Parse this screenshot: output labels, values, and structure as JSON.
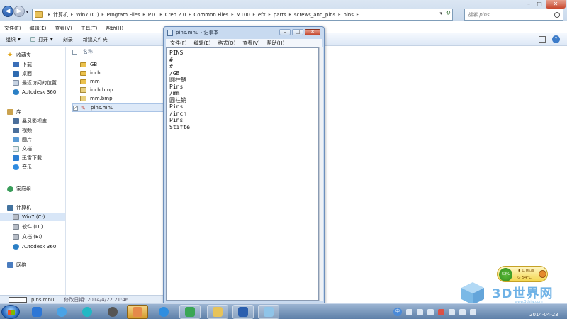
{
  "explorer": {
    "breadcrumbs": [
      "计算机",
      "Win7 (C:)",
      "Program Files",
      "PTC",
      "Creo 2.0",
      "Common Files",
      "M100",
      "efx",
      "parts",
      "screws_and_pins",
      "pins"
    ],
    "search_placeholder": "搜索 pins",
    "menu": [
      "文件(F)",
      "编辑(E)",
      "查看(V)",
      "工具(T)",
      "帮助(H)"
    ],
    "toolbar": {
      "organize": "组织",
      "open": "打开",
      "burn": "刻录",
      "new_folder": "新建文件夹"
    },
    "nav": {
      "favorites_header": "收藏夹",
      "favorites": [
        "下载",
        "桌面",
        "最近访问的位置",
        "Autodesk 360"
      ],
      "libraries_header": "库",
      "libraries": [
        "暴风影视库",
        "视频",
        "图片",
        "文档",
        "迅雷下载",
        "音乐"
      ],
      "homegroup": "家庭组",
      "computer_header": "计算机",
      "drives": [
        "Win7 (C:)",
        "软件 (D:)",
        "文档 (E:)",
        "Autodesk 360"
      ],
      "network": "网络"
    },
    "column_name": "名称",
    "files": [
      {
        "name": "GB",
        "type": "folder"
      },
      {
        "name": "inch",
        "type": "folder"
      },
      {
        "name": "mm",
        "type": "folder"
      },
      {
        "name": "inch.bmp",
        "type": "bmp"
      },
      {
        "name": "mm.bmp",
        "type": "bmp"
      },
      {
        "name": "pins.mnu",
        "type": "mnu",
        "selected": true
      }
    ],
    "details": {
      "filename": "pins.mnu",
      "modified_label": "修改日期: 2014/4/22 21:46"
    }
  },
  "notepad": {
    "title": "pins.mnu - 记事本",
    "menu": [
      "文件(F)",
      "编辑(E)",
      "格式(O)",
      "查看(V)",
      "帮助(H)"
    ],
    "lines": [
      "PINS",
      "#",
      "#",
      "/GB",
      "圆柱销",
      "Pins",
      "/mm",
      "圆柱销",
      "Pins",
      "/inch",
      "Pins",
      "Stifte"
    ]
  },
  "netmon": {
    "percent": "52%",
    "speed": "0.0K/s",
    "temp": "54°C"
  },
  "clock": {
    "date": "2014-04-23"
  },
  "watermark": {
    "brand": "3D世界网",
    "url": "www.3dsjw.com"
  },
  "colors": {
    "accent": "#2b5fae",
    "selection": "#d8e6f7",
    "taskbar": "#5d7fa8",
    "watermark": "#6fb2e6"
  }
}
